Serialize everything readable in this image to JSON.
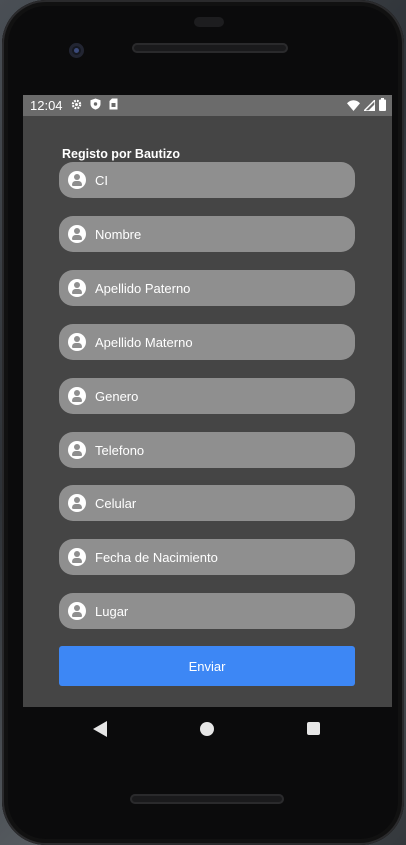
{
  "status_bar": {
    "time": "12:04",
    "left_icons": [
      "gear-icon",
      "shield-icon",
      "sim-card-icon"
    ],
    "right_icons": [
      "wifi-icon",
      "signal-icon",
      "battery-icon"
    ]
  },
  "form": {
    "title": "Registo por Bautizo",
    "fields": [
      {
        "placeholder": "CI",
        "icon": "user-circle-icon"
      },
      {
        "placeholder": "Nombre",
        "icon": "user-circle-icon"
      },
      {
        "placeholder": "Apellido Paterno",
        "icon": "user-circle-icon"
      },
      {
        "placeholder": "Apellido Materno",
        "icon": "user-circle-icon"
      },
      {
        "placeholder": "Genero",
        "icon": "user-circle-icon"
      },
      {
        "placeholder": "Telefono",
        "icon": "user-circle-icon"
      },
      {
        "placeholder": "Celular",
        "icon": "user-circle-icon"
      },
      {
        "placeholder": "Fecha de Nacimiento",
        "icon": "user-circle-icon"
      },
      {
        "placeholder": "Lugar",
        "icon": "user-circle-icon"
      }
    ],
    "submit_label": "Enviar"
  },
  "nav_bar": {
    "buttons": [
      "back-icon",
      "home-icon",
      "recents-icon"
    ]
  },
  "colors": {
    "screen_bg": "#454545",
    "field_bg": "#8f8f8f",
    "button_bg": "#3d87f5",
    "status_bar_bg": "#6b6b6b"
  }
}
